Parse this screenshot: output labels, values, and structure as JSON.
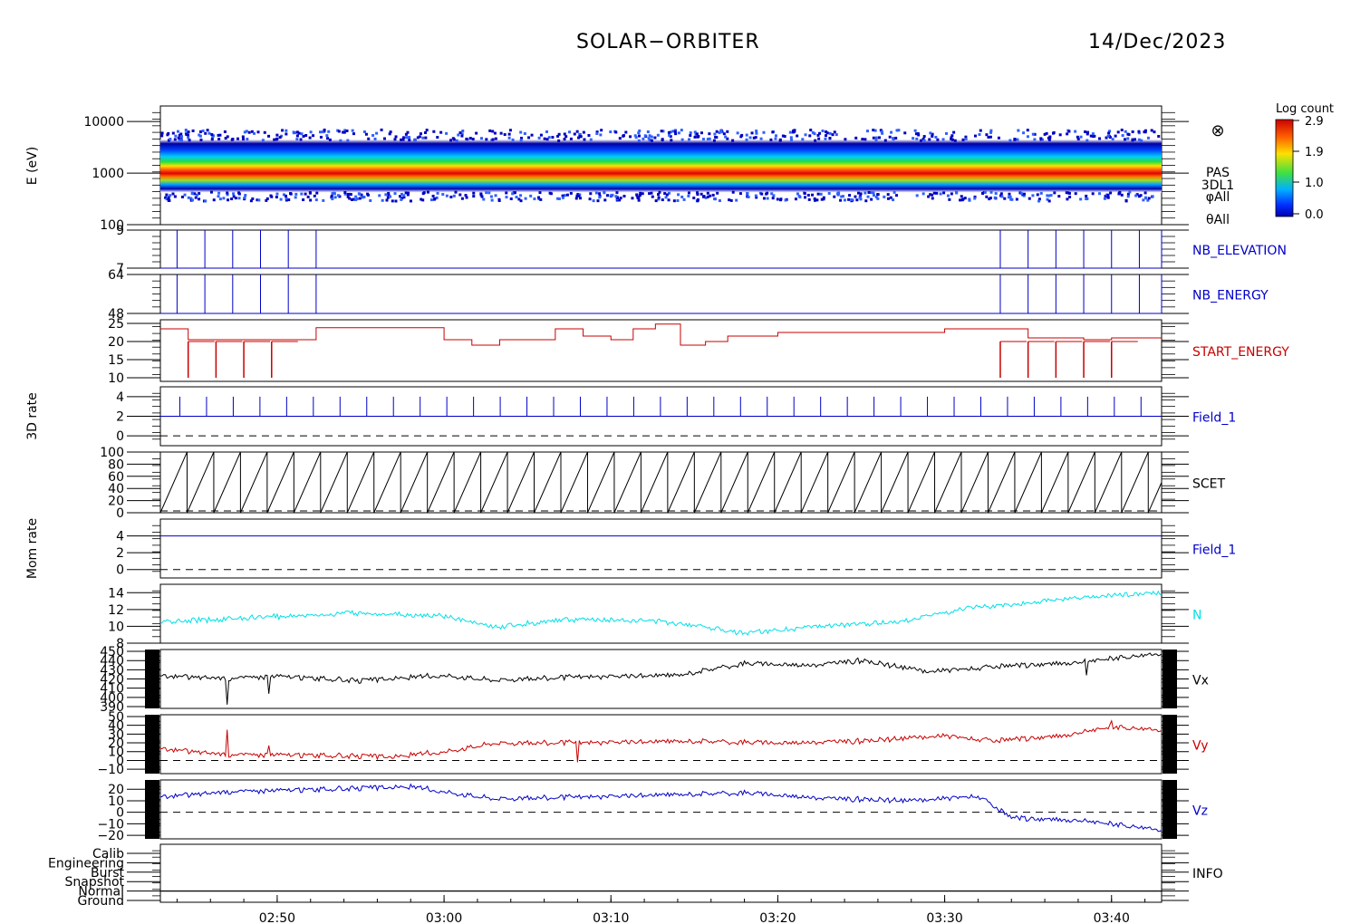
{
  "header": {
    "title": "SOLAR−ORBITER",
    "date": "14/Dec/2023"
  },
  "colorbar": {
    "title": "Log count",
    "ticks": [
      "2.9",
      "1.9",
      "1.0",
      "0.0"
    ]
  },
  "spectrogram_labels": {
    "symbol": "⊗",
    "lines": [
      "PAS",
      "3DL1",
      "φAll",
      "θAll"
    ]
  },
  "colors": {
    "blue": "#0000c8",
    "red": "#c80000",
    "cyan": "#00e0e8",
    "black": "#000000"
  },
  "chart_data": {
    "type": "line",
    "title": "SOLAR−ORBITER",
    "date": "14/Dec/2023",
    "x_axis": {
      "ticks": [
        "02:50",
        "03:00",
        "03:10",
        "03:20",
        "03:30",
        "03:40"
      ],
      "start": "02:43",
      "end": "03:43"
    },
    "panels": [
      {
        "id": "spectrogram",
        "type": "heatmap",
        "ylabel": "E (eV)",
        "yscale": "log",
        "yticks": [
          "10000",
          "1000",
          "100"
        ],
        "ylim": [
          100,
          20000
        ],
        "peak_energy_ev": 900,
        "band_ev": [
          500,
          3000
        ],
        "colorbar": {
          "title": "Log count",
          "range": [
            0.0,
            2.9
          ]
        }
      },
      {
        "id": "nb_elevation",
        "label": "NB_ELEVATION",
        "color": "blue",
        "ylim": [
          7,
          9
        ],
        "yticks": [
          "9",
          "7"
        ],
        "baseline": 7,
        "spike_value": 9,
        "spike_times": [
          "02:44",
          "02:45:40",
          "02:47:20",
          "02:49",
          "02:50:40",
          "02:52:20",
          "03:33:20",
          "03:35",
          "03:36:40",
          "03:38:20",
          "03:40",
          "03:41:40",
          "03:43"
        ]
      },
      {
        "id": "nb_energy",
        "label": "NB_ENERGY",
        "color": "blue",
        "ylim": [
          48,
          64
        ],
        "yticks": [
          "64",
          "48"
        ],
        "baseline": 48,
        "spike_value": 64,
        "spike_times": [
          "02:44",
          "02:45:40",
          "02:47:20",
          "02:49",
          "02:50:40",
          "02:52:20",
          "03:33:20",
          "03:35",
          "03:36:40",
          "03:38:20",
          "03:40",
          "03:41:40",
          "03:43"
        ]
      },
      {
        "id": "start_energy",
        "label": "START_ENERGY",
        "color": "red",
        "ylim": [
          9,
          26
        ],
        "yticks": [
          "25",
          "20",
          "15",
          "10"
        ],
        "steps": [
          [
            "02:43",
            23.5
          ],
          [
            "02:44:40",
            20.5
          ],
          [
            "02:52:20",
            23.8
          ],
          [
            "03:00",
            20.5
          ],
          [
            "03:01:40",
            19
          ],
          [
            "03:03:20",
            20.5
          ],
          [
            "03:06:40",
            23.5
          ],
          [
            "03:08:20",
            21.5
          ],
          [
            "03:10",
            20.5
          ],
          [
            "03:11:20",
            23.5
          ],
          [
            "03:12:40",
            24.8
          ],
          [
            "03:14:10",
            19
          ],
          [
            "03:15:40",
            20
          ],
          [
            "03:17:00",
            21.5
          ],
          [
            "03:20",
            22.5
          ],
          [
            "03:30",
            23.5
          ],
          [
            "03:33:20",
            23.5
          ],
          [
            "03:35",
            21
          ],
          [
            "03:36:40",
            21
          ],
          [
            "03:38:20",
            20.5
          ],
          [
            "03:40",
            21
          ],
          [
            "03:41:40",
            21
          ],
          [
            "03:43",
            21
          ]
        ],
        "dips": [
          "02:44:40",
          "02:46:20",
          "02:48",
          "02:49:40",
          "03:33:20",
          "03:35",
          "03:36:40",
          "03:38:20",
          "03:40"
        ],
        "dip_value": 10
      },
      {
        "id": "field1_3d",
        "label": "Field_1",
        "color": "blue",
        "ylabel": "3D rate",
        "ylim": [
          -1,
          5
        ],
        "yticks": [
          "4",
          "2",
          "0"
        ],
        "baseline": 2,
        "spike_value": 4,
        "spike_period_s": 96,
        "zero_line": 0
      },
      {
        "id": "scet",
        "label": "SCET",
        "color": "black",
        "ylim": [
          0,
          100
        ],
        "yticks": [
          "100",
          "80",
          "60",
          "40",
          "20",
          "0"
        ],
        "sawtooth_period_s": 96,
        "min": 0,
        "max": 100
      },
      {
        "id": "field1_mom",
        "label": "Field_1",
        "color": "blue",
        "ylabel": "Mom rate",
        "ylim": [
          -1,
          6
        ],
        "yticks": [
          "4",
          "2",
          "0"
        ],
        "value": 4,
        "zero_line": 0
      },
      {
        "id": "n",
        "label": "N",
        "color": "cyan",
        "ylim": [
          8,
          15
        ],
        "yticks": [
          "14",
          "12",
          "10",
          "8"
        ],
        "x": [
          "02:43",
          "02:48",
          "02:55",
          "03:00",
          "03:03",
          "03:07",
          "03:12",
          "03:15",
          "03:18",
          "03:22",
          "03:27",
          "03:31",
          "03:35",
          "03:39",
          "03:43"
        ],
        "values": [
          10.5,
          11.0,
          11.6,
          11.2,
          9.9,
          10.8,
          10.7,
          10.2,
          9.2,
          9.9,
          10.5,
          12.0,
          12.8,
          13.5,
          14.0
        ]
      },
      {
        "id": "vx",
        "label": "Vx",
        "color": "black",
        "ylim": [
          388,
          452
        ],
        "yticks": [
          "450",
          "440",
          "430",
          "420",
          "410",
          "400",
          "390"
        ],
        "x": [
          "02:43",
          "02:47",
          "02:50",
          "02:55",
          "03:00",
          "03:03",
          "03:08",
          "03:14",
          "03:18",
          "03:22",
          "03:25",
          "03:29",
          "03:33",
          "03:38",
          "03:43"
        ],
        "values": [
          423,
          421,
          423,
          418,
          424,
          419,
          422,
          424,
          437,
          435,
          440,
          428,
          433,
          438,
          448
        ],
        "dips": [
          [
            "02:47",
            392
          ],
          [
            "02:49:30",
            404
          ],
          [
            "03:38:30",
            424
          ]
        ]
      },
      {
        "id": "vy",
        "label": "Vy",
        "color": "red",
        "ylim": [
          -15,
          52
        ],
        "yticks": [
          "50",
          "40",
          "30",
          "20",
          "10",
          "0",
          "−10"
        ],
        "zero_line": 0,
        "x": [
          "02:43",
          "02:47",
          "02:52",
          "02:57",
          "03:00",
          "03:03",
          "03:08",
          "03:15",
          "03:20",
          "03:25",
          "03:30",
          "03:33",
          "03:37",
          "03:40",
          "03:43"
        ],
        "values": [
          13,
          7,
          6,
          4,
          10,
          20,
          20,
          22,
          20,
          22,
          28,
          22,
          28,
          38,
          35
        ],
        "spikes": [
          [
            "02:47",
            35
          ],
          [
            "02:49:30",
            17
          ],
          [
            "03:08",
            -2
          ],
          [
            "03:40",
            45
          ]
        ]
      },
      {
        "id": "vz",
        "label": "Vz",
        "color": "blue",
        "ylim": [
          -23,
          28
        ],
        "yticks": [
          "20",
          "10",
          "0",
          "−10",
          "−20"
        ],
        "zero_line": 0,
        "x": [
          "02:43",
          "02:47",
          "02:53",
          "02:58",
          "03:03",
          "03:08",
          "03:13",
          "03:18",
          "03:23",
          "03:28",
          "03:32",
          "03:34",
          "03:38",
          "03:43"
        ],
        "values": [
          13,
          18,
          20,
          22,
          12,
          13,
          15,
          17,
          12,
          10,
          14,
          -5,
          -7,
          -15
        ]
      },
      {
        "id": "info",
        "label": "INFO",
        "color": "black",
        "categories": [
          "Calib",
          "Engineering",
          "Burst",
          "Snapshot",
          "Normal",
          "Ground"
        ],
        "state": "Normal"
      }
    ]
  }
}
